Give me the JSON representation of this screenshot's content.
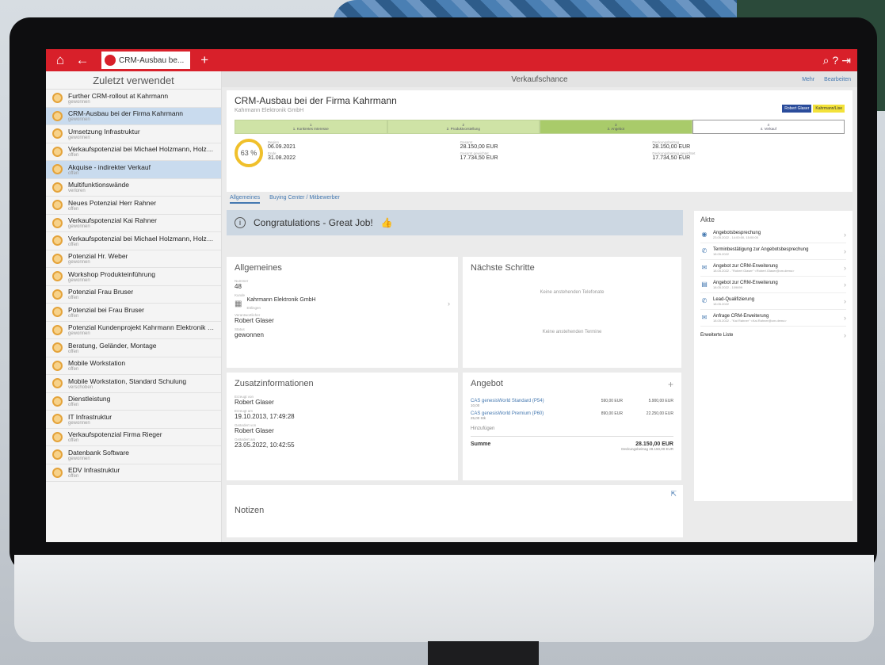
{
  "tab": {
    "label": "CRM-Ausbau be..."
  },
  "sidebar": {
    "title": "Zuletzt verwendet",
    "items": [
      {
        "title": "Further CRM-rollout at Kahrmann",
        "status": "gewonnen"
      },
      {
        "title": "CRM-Ausbau bei der Firma Kahrmann",
        "status": "gewonnen"
      },
      {
        "title": "Umsetzung Infrastruktur",
        "status": "gewonnen"
      },
      {
        "title": "Verkaufspotenzial bei Michael Holzmann, Holzmann &...",
        "status": "offen"
      },
      {
        "title": "Akquise - indirekter Verkauf",
        "status": "offen"
      },
      {
        "title": "Multifunktionswände",
        "status": "verloren"
      },
      {
        "title": "Neues Potenzial Herr Rahner",
        "status": "offen"
      },
      {
        "title": "Verkaufspotenzial Kai Rahner",
        "status": "gewonnen"
      },
      {
        "title": "Verkaufspotenzial bei Michael Holzmann, Holzmann &...",
        "status": "offen"
      },
      {
        "title": "Potenzial Hr. Weber",
        "status": "gewonnen"
      },
      {
        "title": "Workshop Produkteinführung",
        "status": "gewonnen"
      },
      {
        "title": "Potenzial Frau Bruser",
        "status": "offen"
      },
      {
        "title": "Potenzial bei Frau Bruser",
        "status": "offen"
      },
      {
        "title": "Potenzial Kundenprojekt Kahrmann Elektronik GmbH",
        "status": "gewonnen"
      },
      {
        "title": "Beratung, Geländer, Montage",
        "status": "offen"
      },
      {
        "title": "Mobile Workstation",
        "status": "offen"
      },
      {
        "title": "Mobile Workstation, Standard Schulung",
        "status": "verschoben"
      },
      {
        "title": "Dienstleistung",
        "status": "offen"
      },
      {
        "title": "IT Infrastruktur",
        "status": "gewonnen"
      },
      {
        "title": "Verkaufspotenzial Firma Rieger",
        "status": "offen"
      },
      {
        "title": "Datenbank Software",
        "status": "gewonnen"
      },
      {
        "title": "EDV Infrastruktur",
        "status": "offen"
      }
    ]
  },
  "page": {
    "title": "Verkaufschance",
    "action1": "Mehr",
    "action2": "Bearbeiten"
  },
  "hero": {
    "title": "CRM-Ausbau bei der Firma Kahrmann",
    "company": "Kahrmann Elektronik GmbH",
    "badge1": "Robert Glaser",
    "badge2": "Kahrmann/Lise",
    "stages": [
      {
        "num": "1",
        "label": "1. Konkretes Interesse"
      },
      {
        "num": "2",
        "label": "2. Produktvorstellung"
      },
      {
        "num": "3",
        "label": "3. Angebot"
      },
      {
        "num": "4",
        "label": "4. Verkauf"
      }
    ],
    "percent": "63 %",
    "begin_label": "Beginn",
    "begin": "06.09.2021",
    "end_label": "Ende",
    "end": "31.08.2022",
    "total_label": "Gesamt",
    "total": "28.150,00 EUR",
    "weighted_label": "Gesamt gewichtet",
    "weighted": "17.734,50 EUR",
    "margin_label": "Deckungsbeitrag",
    "margin": "28.150,00 EUR",
    "margin_w_label": "Deckungsbeitrag gewichtet",
    "margin_w": "17.734,50 EUR"
  },
  "tabs": {
    "general": "Allgemeines",
    "buying": "Buying Center / Mitbewerber"
  },
  "congrats": {
    "text": "Congratulations - Great Job!"
  },
  "general": {
    "title": "Allgemeines",
    "number_label": "Nummer",
    "number": "48",
    "customer_label": "Kunde",
    "customer": "Kahrmann Elektronik GmbH",
    "customer_city": "Ettlingen",
    "owner_label": "Verantwortlicher",
    "owner": "Robert Glaser",
    "status_label": "Status",
    "status": "gewonnen"
  },
  "next": {
    "title": "Nächste Schritte",
    "empty_calls": "Keine anstehenden Telefonate",
    "empty_dates": "Keine anstehenden Termine"
  },
  "extra": {
    "title": "Zusatzinformationen",
    "created_by_label": "Erzeugt von",
    "created_by": "Robert Glaser",
    "created_at_label": "Erzeugt am",
    "created_at": "19.10.2013, 17:49:28",
    "changed_by_label": "Geändert von",
    "changed_by": "Robert Glaser",
    "changed_at_label": "Geändert am",
    "changed_at": "23.05.2022, 10:42:55"
  },
  "offer": {
    "title": "Angebot",
    "rows": [
      {
        "name": "CAS genesisWorld Standard (P54)",
        "qty": "10,00",
        "price": "590,00 EUR",
        "total": "5.900,00 EUR"
      },
      {
        "name": "CAS genesisWorld Premium (P60)",
        "qty": "25,00 Stk",
        "price": "890,00 EUR",
        "total": "22.250,00 EUR"
      }
    ],
    "add": "Hinzufügen",
    "sum_label": "Summe",
    "sum": "28.150,00 EUR",
    "margin": "Deckungsbeitrag 28.150,00 EUR"
  },
  "notes": {
    "title": "Notizen"
  },
  "akte": {
    "title": "Akte",
    "items": [
      {
        "icon": "calendar-icon",
        "title": "Angebotsbesprechung",
        "sub": "23.05.2022 - 14:00:00, 15:00:00"
      },
      {
        "icon": "phone-icon",
        "title": "Terminbestätigung zur Angebotsbesprechung",
        "sub": "18.05.2022"
      },
      {
        "icon": "mail-icon",
        "title": "Angebot zur CRM-Erweiterung",
        "sub": "18.05.2022 - \"Robert Glaser\" <Robert.Glaser@cm.demo>"
      },
      {
        "icon": "document-icon",
        "title": "Angebot zur CRM-Erweiterung",
        "sub": "18.05.2022 - 109699"
      },
      {
        "icon": "phone-icon",
        "title": "Lead-Qualifizierung",
        "sub": "18.05.2022"
      },
      {
        "icon": "mail-icon",
        "title": "Anfrage CRM-Erweiterung",
        "sub": "18.05.2022 - \"Kai Rahner\" <Kai.Rahner@cm.demo>"
      }
    ],
    "more": "Erweiterte Liste"
  }
}
